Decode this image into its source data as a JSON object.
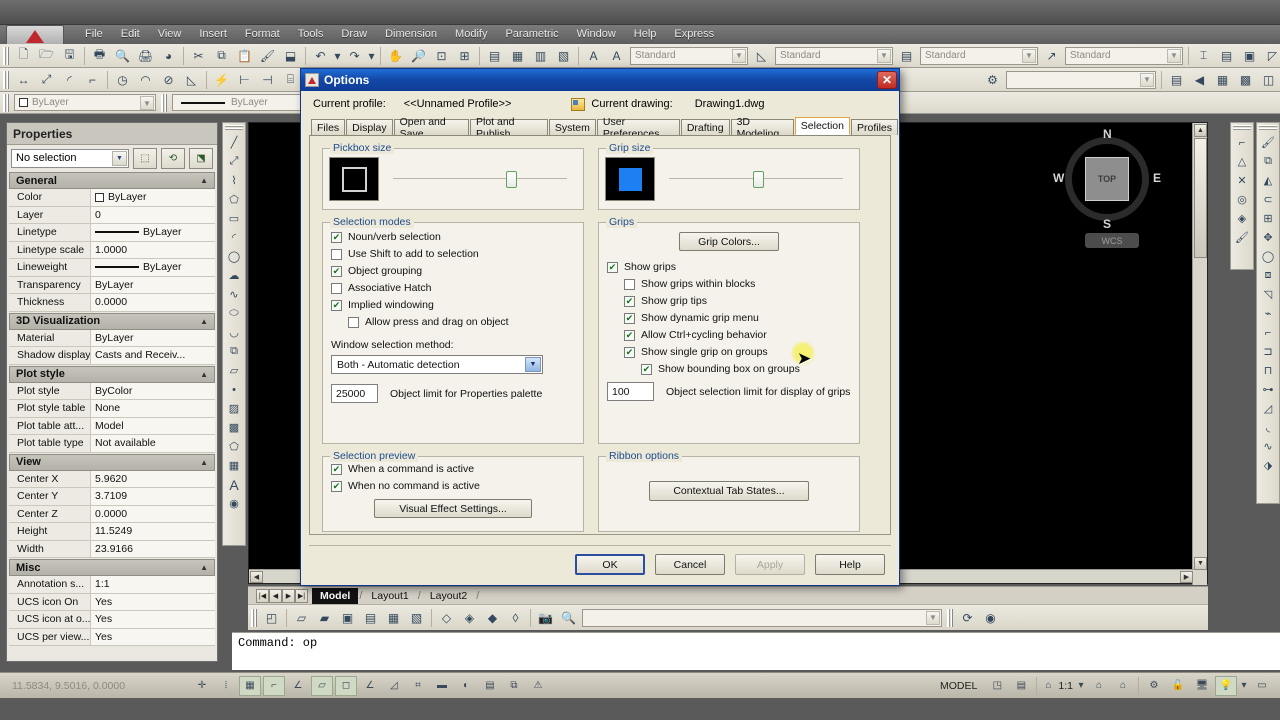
{
  "app": {
    "menu": [
      "File",
      "Edit",
      "View",
      "Insert",
      "Format",
      "Tools",
      "Draw",
      "Dimension",
      "Modify",
      "Parametric",
      "Window",
      "Help",
      "Express"
    ],
    "logo_icon": "autocad-logo-icon"
  },
  "toolbars": {
    "row1_icons": [
      "new-file-icon",
      "open-folder-icon",
      "save-icon",
      "plot-icon",
      "plot-preview-icon",
      "publish-icon",
      "3dprint-icon",
      "cut-icon",
      "copy-icon",
      "paste-icon",
      "match-properties-icon",
      "block-editor-icon",
      "undo-icon",
      "redo-icon"
    ],
    "row2_icons": [
      "linear-dimension-icon",
      "aligned-dimension-icon",
      "arc-length-icon",
      "ordinate-icon",
      "radius-icon",
      "jogged-icon",
      "diameter-icon",
      "angular-icon",
      "quick-dimension-icon",
      "baseline-icon",
      "continue-icon",
      "dimension-space-icon",
      "dimension-break-icon"
    ],
    "style_combos": [
      {
        "icon": "text-style-icon",
        "value": "Standard"
      },
      {
        "icon": "dimension-style-icon",
        "value": "Standard"
      },
      {
        "icon": "table-style-icon",
        "value": "Standard"
      },
      {
        "icon": "mleader-style-icon",
        "value": "Standard"
      }
    ],
    "layer_combos": [
      {
        "icon": "color-swatch-icon",
        "value": "ByLayer"
      },
      {
        "icon": "linetype-icon",
        "value": "ByLayer"
      }
    ]
  },
  "properties": {
    "title": "Properties",
    "selection": "No selection",
    "tool_icons": [
      "quick-select-icon",
      "select-objects-icon",
      "toggle-value-icon"
    ],
    "groups": [
      {
        "name": "General",
        "rows": [
          {
            "key": "Color",
            "value": "ByLayer",
            "icon": "color-swatch-icon"
          },
          {
            "key": "Layer",
            "value": "0"
          },
          {
            "key": "Linetype",
            "value": "ByLayer",
            "icon": "linetype-icon"
          },
          {
            "key": "Linetype scale",
            "value": "1.0000"
          },
          {
            "key": "Lineweight",
            "value": "ByLayer",
            "icon": "linetype-icon"
          },
          {
            "key": "Transparency",
            "value": "ByLayer"
          },
          {
            "key": "Thickness",
            "value": "0.0000"
          }
        ]
      },
      {
        "name": "3D Visualization",
        "rows": [
          {
            "key": "Material",
            "value": "ByLayer"
          },
          {
            "key": "Shadow display",
            "value": "Casts and Receiv..."
          }
        ]
      },
      {
        "name": "Plot style",
        "rows": [
          {
            "key": "Plot style",
            "value": "ByColor"
          },
          {
            "key": "Plot style table",
            "value": "None"
          },
          {
            "key": "Plot table att...",
            "value": "Model"
          },
          {
            "key": "Plot table type",
            "value": "Not available"
          }
        ]
      },
      {
        "name": "View",
        "rows": [
          {
            "key": "Center X",
            "value": "5.9620"
          },
          {
            "key": "Center Y",
            "value": "3.7109"
          },
          {
            "key": "Center Z",
            "value": "0.0000"
          },
          {
            "key": "Height",
            "value": "11.5249"
          },
          {
            "key": "Width",
            "value": "23.9166"
          }
        ]
      },
      {
        "name": "Misc",
        "rows": [
          {
            "key": "Annotation s...",
            "value": "1:1"
          },
          {
            "key": "UCS icon On",
            "value": "Yes"
          },
          {
            "key": "UCS icon at o...",
            "value": "Yes"
          },
          {
            "key": "UCS per view...",
            "value": "Yes"
          }
        ]
      }
    ]
  },
  "canvas": {
    "viewcube": {
      "top_label": "TOP",
      "north": "N",
      "south": "S",
      "east": "E",
      "west": "W"
    },
    "ucs_button": "WCS"
  },
  "layout_tabs": {
    "tabs": [
      "Model",
      "Layout1",
      "Layout2"
    ],
    "active": "Model"
  },
  "command_line": {
    "text": "Command:  op"
  },
  "status_bar": {
    "coords": "11.5834, 9.5016, 0.0000",
    "toggle_icons": [
      "infer-constraints-icon",
      "snap-mode-icon",
      "grid-display-icon",
      "ortho-mode-icon",
      "polar-tracking-icon",
      "object-snap-icon",
      "3d-object-snap-icon",
      "object-snap-tracking-icon",
      "dynamic-ucs-icon"
    ],
    "space_label": "MODEL",
    "scale": "1:1",
    "right_icons": [
      "model-space-icon",
      "viewport-icon",
      "annotation-scale-icon",
      "annotation-visibility-icon",
      "auto-scale-icon",
      "workspace-gear-icon",
      "lock-icon",
      "hardware-accel-icon",
      "clean-screen-icon"
    ]
  },
  "dialog": {
    "title": "Options",
    "icon": "autocad-options-icon",
    "close_label": "✕",
    "profile_label": "Current profile:",
    "profile_value": "<<Unnamed Profile>>",
    "drawing_label": "Current drawing:",
    "drawing_value": "Drawing1.dwg",
    "tabs": [
      "Files",
      "Display",
      "Open and Save",
      "Plot and Publish",
      "System",
      "User Preferences",
      "Drafting",
      "3D Modeling",
      "Selection",
      "Profiles"
    ],
    "active_tab": "Selection",
    "pickbox": {
      "legend": "Pickbox size",
      "slider_percent": 65
    },
    "gripsize": {
      "legend": "Grip size",
      "slider_percent": 48,
      "color": "#1c7ff2"
    },
    "selection_modes": {
      "legend": "Selection modes",
      "checkboxes": [
        {
          "label": "Noun/verb selection",
          "checked": true,
          "indent": 0
        },
        {
          "label": "Use Shift to add to selection",
          "checked": false,
          "indent": 0
        },
        {
          "label": "Object grouping",
          "checked": true,
          "indent": 0
        },
        {
          "label": "Associative Hatch",
          "checked": false,
          "indent": 0
        },
        {
          "label": "Implied windowing",
          "checked": true,
          "indent": 0
        },
        {
          "label": "Allow press and drag on object",
          "checked": false,
          "indent": 1
        }
      ],
      "window_method_label": "Window selection method:",
      "window_method_value": "Both - Automatic detection",
      "object_limit_value": "25000",
      "object_limit_label": "Object limit for Properties palette"
    },
    "grips": {
      "legend": "Grips",
      "grip_colors_button": "Grip Colors...",
      "checkboxes": [
        {
          "label": "Show grips",
          "checked": true,
          "indent": 0
        },
        {
          "label": "Show grips within blocks",
          "checked": false,
          "indent": 1
        },
        {
          "label": "Show grip tips",
          "checked": true,
          "indent": 1
        },
        {
          "label": "Show dynamic grip menu",
          "checked": true,
          "indent": 1
        },
        {
          "label": "Allow Ctrl+cycling behavior",
          "checked": true,
          "indent": 1
        },
        {
          "label": "Show single grip on groups",
          "checked": true,
          "indent": 1
        },
        {
          "label": "Show bounding box on groups",
          "checked": true,
          "indent": 2
        }
      ],
      "selection_limit_value": "100",
      "selection_limit_label": "Object selection limit for display of grips"
    },
    "selection_preview": {
      "legend": "Selection preview",
      "checkboxes": [
        {
          "label": "When a command is active",
          "checked": true
        },
        {
          "label": "When no command is active",
          "checked": true
        }
      ],
      "visual_effect_button": "Visual Effect Settings..."
    },
    "ribbon_options": {
      "legend": "Ribbon options",
      "contextual_button": "Contextual Tab States..."
    },
    "footer_buttons": [
      {
        "label": "OK",
        "enabled": true,
        "default": true
      },
      {
        "label": "Cancel",
        "enabled": true,
        "default": false
      },
      {
        "label": "Apply",
        "enabled": false,
        "default": false
      },
      {
        "label": "Help",
        "enabled": true,
        "default": false
      }
    ]
  }
}
